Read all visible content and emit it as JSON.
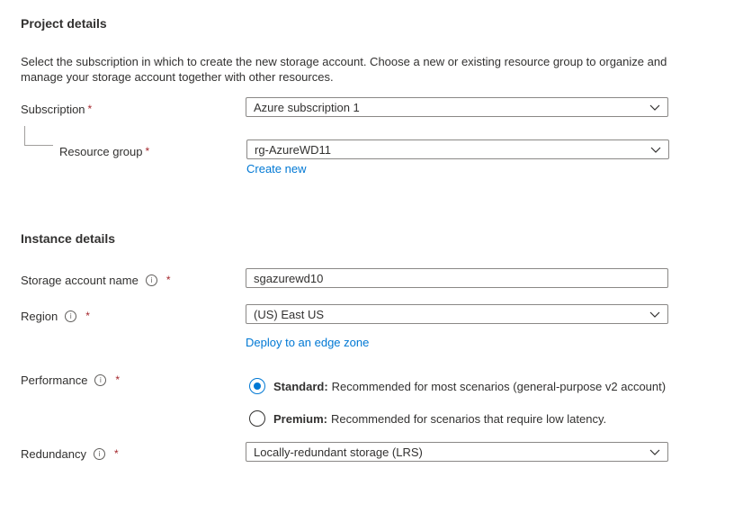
{
  "project": {
    "heading": "Project details",
    "description": "Select the subscription in which to create the new storage account. Choose a new or existing resource group to organize and manage your storage account together with other resources.",
    "subscription_label": "Subscription",
    "subscription_value": "Azure subscription 1",
    "resource_group_label": "Resource group",
    "resource_group_value": "rg-AzureWD11",
    "create_new_link": "Create new"
  },
  "instance": {
    "heading": "Instance details",
    "storage_name_label": "Storage account name",
    "storage_name_value": "sgazurewd10",
    "region_label": "Region",
    "region_value": "(US) East US",
    "edge_zone_link": "Deploy to an edge zone",
    "performance_label": "Performance",
    "performance_options": [
      {
        "title": "Standard:",
        "text": "Recommended for most scenarios (general-purpose v2 account)",
        "selected": true
      },
      {
        "title": "Premium:",
        "text": "Recommended for scenarios that require low latency.",
        "selected": false
      }
    ],
    "redundancy_label": "Redundancy",
    "redundancy_value": "Locally-redundant storage (LRS)"
  },
  "required_marker": "*",
  "info_glyph": "i",
  "colors": {
    "accent": "#0078d4",
    "required": "#a4262c",
    "border": "#8a8886"
  }
}
